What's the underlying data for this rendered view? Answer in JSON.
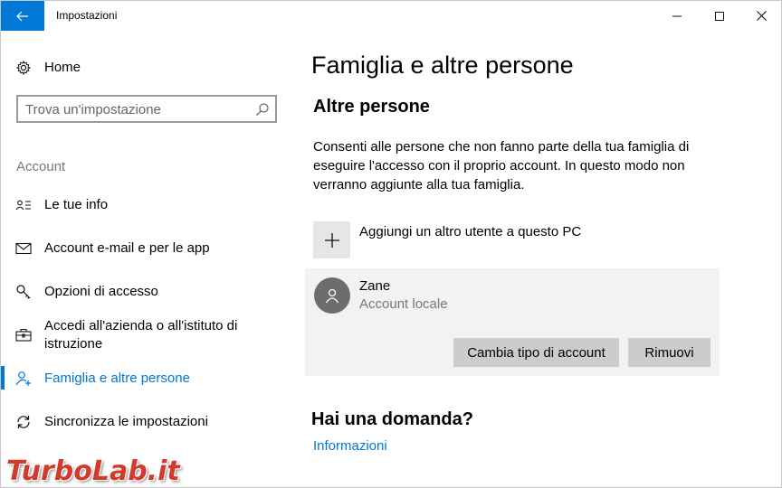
{
  "window": {
    "title": "Impostazioni"
  },
  "sidebar": {
    "home_label": "Home",
    "search_placeholder": "Trova un'impostazione",
    "section_label": "Account",
    "items": [
      {
        "label": "Le tue info",
        "icon": "contact-card-icon",
        "selected": false
      },
      {
        "label": "Account e-mail e per le app",
        "icon": "mail-icon",
        "selected": false
      },
      {
        "label": "Opzioni di accesso",
        "icon": "key-icon",
        "selected": false
      },
      {
        "label": "Accedi all'azienda o all'istituto di istruzione",
        "icon": "briefcase-icon",
        "selected": false
      },
      {
        "label": "Famiglia e altre persone",
        "icon": "person-add-icon",
        "selected": true
      },
      {
        "label": "Sincronizza le impostazioni",
        "icon": "sync-icon",
        "selected": false
      }
    ]
  },
  "main": {
    "title": "Famiglia e altre persone",
    "section_title": "Altre persone",
    "description": "Consenti alle persone che non fanno parte della tua famiglia di eseguire l'accesso con il proprio account. In questo modo non verranno aggiunte alla tua famiglia.",
    "add_user_label": "Aggiungi un altro utente a questo PC",
    "account": {
      "name": "Zane",
      "type": "Account locale",
      "change_type_label": "Cambia tipo di account",
      "remove_label": "Rimuovi"
    },
    "question_title": "Hai una domanda?",
    "info_link": "Informazioni"
  },
  "watermark": {
    "text": "TurboLab.it"
  },
  "colors": {
    "accent": "#0078d7",
    "card_background": "#f2f2f2",
    "button_background": "#cccccc",
    "watermark": "#d23a2a"
  }
}
